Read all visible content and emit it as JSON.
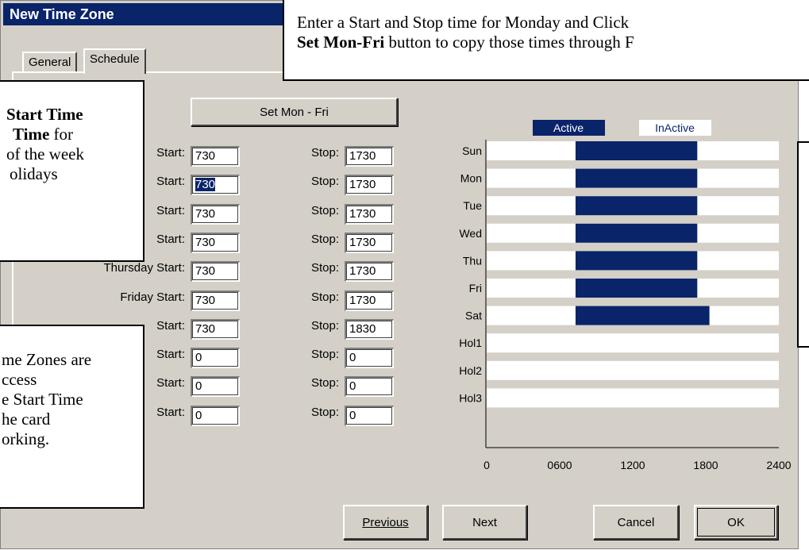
{
  "window": {
    "title": "New Time Zone"
  },
  "tabs": [
    {
      "label": "General"
    },
    {
      "label": "Schedule"
    }
  ],
  "set_button_label": "Set Mon - Fri",
  "rows": [
    {
      "start_label": "Start:",
      "start": "730",
      "stop_label": "Stop:",
      "stop": "1730"
    },
    {
      "start_label": "Start:",
      "start": "730",
      "stop_label": "Stop:",
      "stop": "1730"
    },
    {
      "start_label": "Start:",
      "start": "730",
      "stop_label": "Stop:",
      "stop": "1730"
    },
    {
      "start_label": "Start:",
      "start": "730",
      "stop_label": "Stop:",
      "stop": "1730"
    },
    {
      "start_label": "Thursday Start:",
      "start": "730",
      "stop_label": "Stop:",
      "stop": "1730"
    },
    {
      "start_label": "Friday Start:",
      "start": "730",
      "stop_label": "Stop:",
      "stop": "1730"
    },
    {
      "start_label": "Start:",
      "start": "730",
      "stop_label": "Stop:",
      "stop": "1830"
    },
    {
      "start_label": "Start:",
      "start": "0",
      "stop_label": "Stop:",
      "stop": "0"
    },
    {
      "start_label": "Start:",
      "start": "0",
      "stop_label": "Stop:",
      "stop": "0"
    },
    {
      "start_label": "Start:",
      "start": "0",
      "stop_label": "Stop:",
      "stop": "0"
    }
  ],
  "legend": {
    "active": "Active",
    "inactive": "InActive"
  },
  "chart_data": {
    "type": "bar",
    "orientation": "horizontal-range",
    "categories": [
      "Sun",
      "Mon",
      "Tue",
      "Wed",
      "Thu",
      "Fri",
      "Sat",
      "Hol1",
      "Hol2",
      "Hol3"
    ],
    "series": [
      {
        "name": "Active",
        "ranges": [
          [
            730,
            1730
          ],
          [
            730,
            1730
          ],
          [
            730,
            1730
          ],
          [
            730,
            1730
          ],
          [
            730,
            1730
          ],
          [
            730,
            1730
          ],
          [
            730,
            1830
          ],
          null,
          null,
          null
        ]
      }
    ],
    "x_ticks": [
      "0",
      "0600",
      "1200",
      "1800",
      "2400"
    ],
    "xlim": [
      0,
      2400
    ],
    "colors": {
      "active": "#0a246a",
      "inactive": "#ffffff"
    }
  },
  "buttons": {
    "previous": "Previous",
    "next": "Next",
    "cancel": "Cancel",
    "ok": "OK"
  },
  "callouts": {
    "top_line1": "Enter a Start and Stop time for Monday and Click",
    "top_bold": "Set Mon-Fri",
    "top_line2": " button to copy those times through F",
    "left1_bold1": "Start Time",
    "left1_bold2": "Time",
    "left1_text1": " for",
    "left1_line3": "of the week",
    "left1_line4": "olidays",
    "left2_lines": [
      "me Zones are",
      "ccess",
      "e Start Time",
      "he card",
      "orking."
    ]
  },
  "colors": {
    "accent": "#0a246a",
    "face": "#d4d0c8"
  }
}
